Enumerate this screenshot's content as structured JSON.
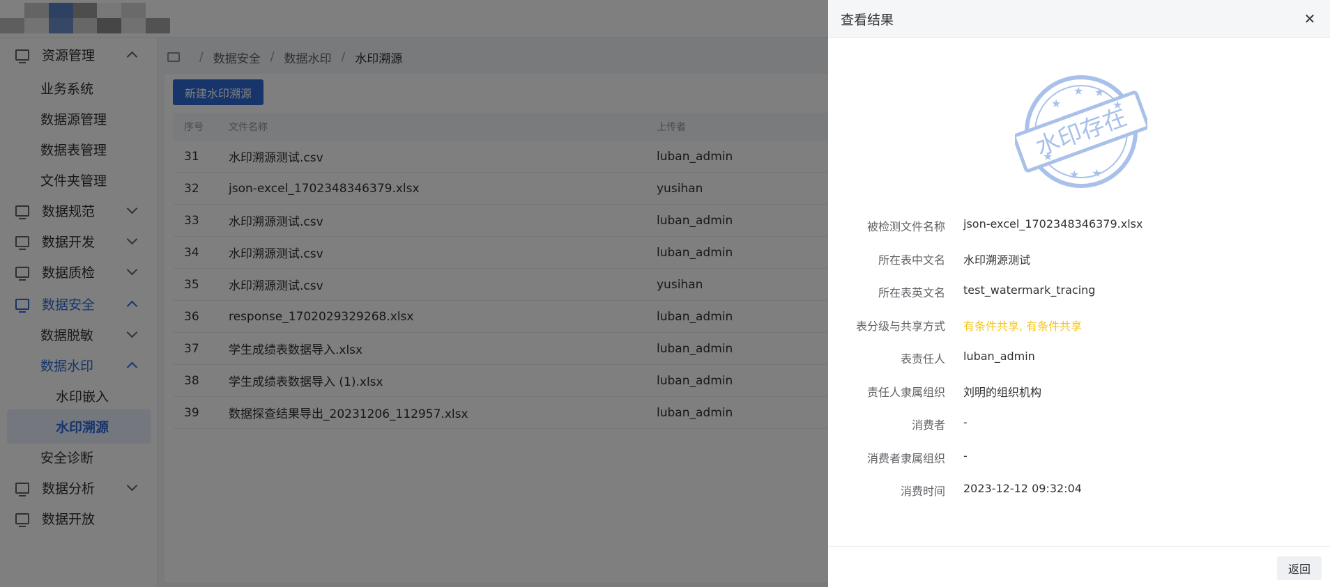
{
  "logo": {
    "colors": [
      "#ffffff",
      "#c8c8c8",
      "#5a82c4",
      "#9a9a9a",
      "#f0f0f0",
      "#d4d4d4",
      "#ffffff",
      "#bdbdbd",
      "#e6e6e6",
      "#6d90cc",
      "#cfcfcf",
      "#8c8c8c",
      "#e2e2e2",
      "#a5a5a5"
    ]
  },
  "sidebar": {
    "items": [
      {
        "label": "资源管理",
        "icon": "monitor-icon",
        "level": 1,
        "state": "expanded"
      },
      {
        "label": "业务系统",
        "level": 2
      },
      {
        "label": "数据源管理",
        "level": 2
      },
      {
        "label": "数据表管理",
        "level": 2
      },
      {
        "label": "文件夹管理",
        "level": 2
      },
      {
        "label": "数据规范",
        "icon": "screen-icon",
        "level": 1,
        "state": "collapsed"
      },
      {
        "label": "数据开发",
        "icon": "code-icon",
        "level": 1,
        "state": "collapsed"
      },
      {
        "label": "数据质检",
        "icon": "checklist-icon",
        "level": 1,
        "state": "collapsed"
      },
      {
        "label": "数据安全",
        "icon": "shield-check-icon",
        "level": 1,
        "state": "expanded",
        "active": true
      },
      {
        "label": "数据脱敏",
        "level": 2,
        "state": "collapsed"
      },
      {
        "label": "数据水印",
        "level": 2,
        "state": "expanded",
        "active": true
      },
      {
        "label": "水印嵌入",
        "level": 3
      },
      {
        "label": "水印溯源",
        "level": 3,
        "selected": true
      },
      {
        "label": "安全诊断",
        "level": 2
      },
      {
        "label": "数据分析",
        "icon": "chart-icon",
        "level": 1,
        "state": "collapsed"
      },
      {
        "label": "数据开放",
        "icon": "share-icon",
        "level": 1
      }
    ],
    "collapse_icon": "menu-fold-icon"
  },
  "breadcrumb": {
    "items": [
      "数据安全",
      "数据水印",
      "水印溯源"
    ],
    "separator": "/"
  },
  "toolbar": {
    "new_label": "新建水印溯源"
  },
  "table": {
    "headers": [
      "序号",
      "文件名称",
      "上传者"
    ],
    "rows": [
      {
        "idx": "31",
        "name": "水印溯源测试.csv",
        "uploader": "luban_admin"
      },
      {
        "idx": "32",
        "name": "json-excel_1702348346379.xlsx",
        "uploader": "yusihan"
      },
      {
        "idx": "33",
        "name": "水印溯源测试.csv",
        "uploader": "luban_admin"
      },
      {
        "idx": "34",
        "name": "水印溯源测试.csv",
        "uploader": "luban_admin"
      },
      {
        "idx": "35",
        "name": "水印溯源测试.csv",
        "uploader": "yusihan"
      },
      {
        "idx": "36",
        "name": "response_1702029329268.xlsx",
        "uploader": "luban_admin"
      },
      {
        "idx": "37",
        "name": "学生成绩表数据导入.xlsx",
        "uploader": "luban_admin"
      },
      {
        "idx": "38",
        "name": "学生成绩表数据导入 (1).xlsx",
        "uploader": "luban_admin"
      },
      {
        "idx": "39",
        "name": "数据探查结果导出_20231206_112957.xlsx",
        "uploader": "luban_admin"
      }
    ]
  },
  "drawer": {
    "title": "查看结果",
    "close_icon": "close-icon",
    "stamp_text": "水印存在",
    "stamp_color": "#a9c1ea",
    "fields": [
      {
        "label": "被检测文件名称",
        "value": "json-excel_1702348346379.xlsx"
      },
      {
        "label": "所在表中文名",
        "value": "水印溯源测试"
      },
      {
        "label": "所在表英文名",
        "value": "test_watermark_tracing"
      },
      {
        "label": "表分级与共享方式",
        "value": "有条件共享, 有条件共享",
        "highlight": "#f5c518"
      },
      {
        "label": "表责任人",
        "value": "luban_admin"
      },
      {
        "label": "责任人隶属组织",
        "value": "刘明的组织机构"
      },
      {
        "label": "消费者",
        "value": "-"
      },
      {
        "label": "消费者隶属组织",
        "value": "-"
      },
      {
        "label": "消费时间",
        "value": "2023-12-12 09:32:04"
      }
    ],
    "back_label": "返回"
  },
  "colors": {
    "primary": "#2f6bd7",
    "overlay": "rgba(0,0,0,0.5)"
  }
}
